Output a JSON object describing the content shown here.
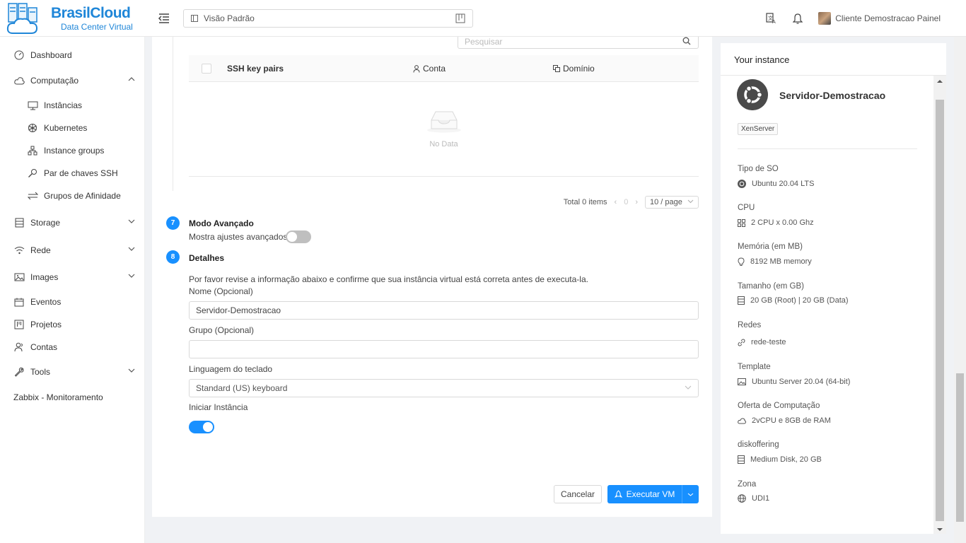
{
  "brand": {
    "name": "BrasilCloud",
    "subtitle": "Data Center Virtual"
  },
  "header": {
    "project_view": "Visão Padrão",
    "user_name": "Cliente Demostracao Painel"
  },
  "sidebar": {
    "items": [
      {
        "label": "Dashboard",
        "icon": "dashboard-icon"
      },
      {
        "label": "Computação",
        "icon": "cloud-icon",
        "expanded": true
      },
      {
        "label": "Instâncias",
        "icon": "desktop-icon"
      },
      {
        "label": "Kubernetes",
        "icon": "kubernetes-icon"
      },
      {
        "label": "Instance groups",
        "icon": "cluster-icon"
      },
      {
        "label": "Par de chaves SSH",
        "icon": "key-icon"
      },
      {
        "label": "Grupos de Afinidade",
        "icon": "swap-icon"
      },
      {
        "label": "Storage",
        "icon": "database-icon"
      },
      {
        "label": "Rede",
        "icon": "wifi-icon"
      },
      {
        "label": "Images",
        "icon": "picture-icon"
      },
      {
        "label": "Eventos",
        "icon": "schedule-icon"
      },
      {
        "label": "Projetos",
        "icon": "project-icon"
      },
      {
        "label": "Contas",
        "icon": "team-icon"
      },
      {
        "label": "Tools",
        "icon": "tool-icon"
      },
      {
        "label": "Zabbix - Monitoramento"
      }
    ]
  },
  "main": {
    "search_placeholder": "Pesquisar",
    "table": {
      "columns": [
        "SSH key pairs",
        "Conta",
        "Domínio"
      ],
      "empty_text": "No Data"
    },
    "pagination": {
      "total": "Total 0 items",
      "page": "0",
      "page_size": "10 / page"
    },
    "steps": {
      "advanced": {
        "number": "7",
        "title": "Modo Avançado",
        "toggle_label": "Mostra ajustes avançados",
        "enabled": false
      },
      "details": {
        "number": "8",
        "title": "Detalhes",
        "description": "Por favor revise a informação abaixo e confirme que sua instância virtual está correta antes de executa-la.",
        "name_label": "Nome (Opcional)",
        "name_value": "Servidor-Demostracao",
        "group_label": "Grupo (Opcional)",
        "group_value": "",
        "keyboard_label": "Linguagem do teclado",
        "keyboard_value": "Standard (US) keyboard",
        "start_label": "Iniciar Instância",
        "start_enabled": true
      }
    },
    "buttons": {
      "cancel": "Cancelar",
      "run": "Executar VM"
    }
  },
  "instance_panel": {
    "title": "Your instance",
    "name": "Servidor-Demostracao",
    "hypervisor": "XenServer",
    "specs": [
      {
        "label": "Tipo de SO",
        "value": "Ubuntu 20.04 LTS",
        "icon": "ubuntu-icon"
      },
      {
        "label": "CPU",
        "value": "2 CPU x 0.00 Ghz",
        "icon": "appstore-icon"
      },
      {
        "label": "Memória (em MB)",
        "value": "8192 MB memory",
        "icon": "bulb-icon"
      },
      {
        "label": "Tamanho (em GB)",
        "value": "20 GB (Root) | 20 GB (Data)",
        "icon": "hdd-icon"
      },
      {
        "label": "Redes",
        "value": "rede-teste",
        "icon": "network-link-icon"
      },
      {
        "label": "Template",
        "value": "Ubuntu Server 20.04 (64-bit)",
        "icon": "picture-icon"
      },
      {
        "label": "Oferta de Computação",
        "value": "2vCPU e 8GB de RAM",
        "icon": "cloud-icon"
      },
      {
        "label": "diskoffering",
        "value": "Medium Disk, 20 GB",
        "icon": "hdd-icon"
      },
      {
        "label": "Zona",
        "value": "UDI1",
        "icon": "globe-icon"
      }
    ]
  },
  "colors": {
    "primary": "#1890ff",
    "brand": "#1f86d8"
  }
}
